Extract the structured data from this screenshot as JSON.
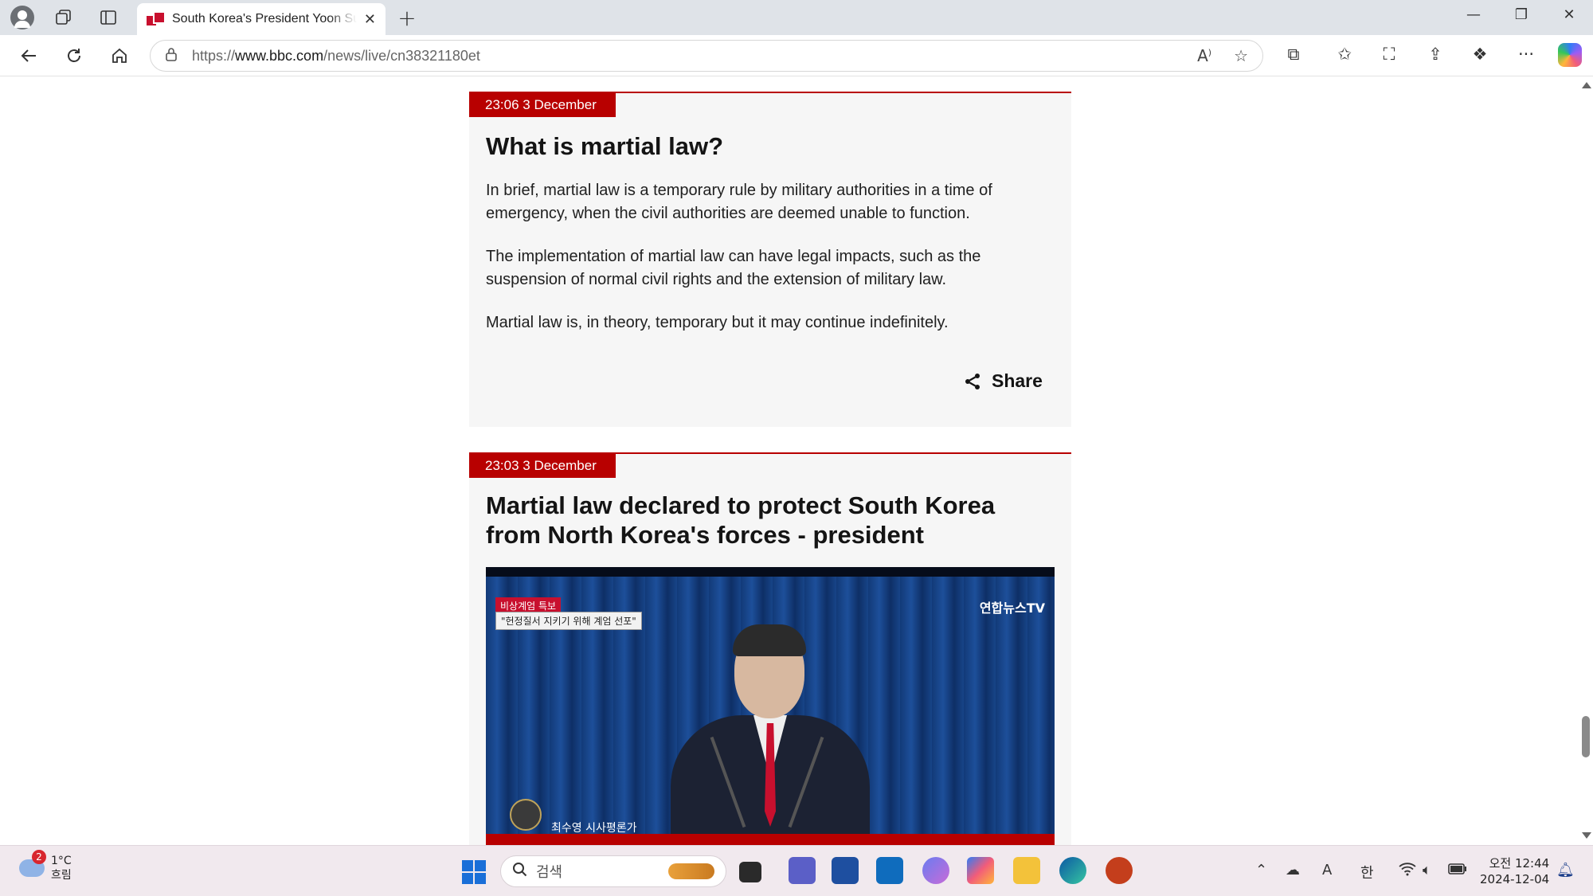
{
  "browser": {
    "tab_title": "South Korea's President Yoon Suk Yeol declares martial law",
    "tab_close": "✕",
    "new_tab": "+",
    "url_prefix": "https://",
    "url_host": "www.bbc.com",
    "url_path": "/news/live/cn38321180et",
    "icons": {
      "back": "back-arrow-icon",
      "refresh": "refresh-icon",
      "home": "home-icon",
      "lock": "lock-icon",
      "read_aloud": "read-aloud-icon",
      "favorite": "star-icon"
    }
  },
  "posts": [
    {
      "timestamp": "23:06 3 December",
      "headline": "What is martial law?",
      "paragraphs": [
        "In brief, martial law is a temporary rule by military authorities in a time of emergency, when the civil authorities are deemed unable to function.",
        "The implementation of martial law can have legal impacts, such as the suspension of normal civil rights and the extension of military law.",
        "Martial law is, in theory, temporary but it may continue indefinitely."
      ],
      "share_label": "Share"
    },
    {
      "timestamp": "23:03 3 December",
      "headline": "Martial law declared to protect South Korea from North Korea's forces - president",
      "image": {
        "tag_red": "비상계엄 특보",
        "tag_white": "\"헌정질서 지키기 위해 계엄 선포\"",
        "channel_logo": "연합뉴스TV",
        "name_caption": "최수영   시사평론가"
      }
    }
  ],
  "taskbar": {
    "weather_badge": "2",
    "weather_temp": "1°C",
    "weather_desc": "흐림",
    "search_placeholder": "검색",
    "clock_time": "오전 12:44",
    "clock_date": "2024-12-04",
    "tray_ime": "한",
    "tray_font": "A"
  },
  "colors": {
    "bbc_red": "#b80000",
    "card_bg": "#f6f6f6",
    "taskbar_bg": "#f1e9ee"
  }
}
